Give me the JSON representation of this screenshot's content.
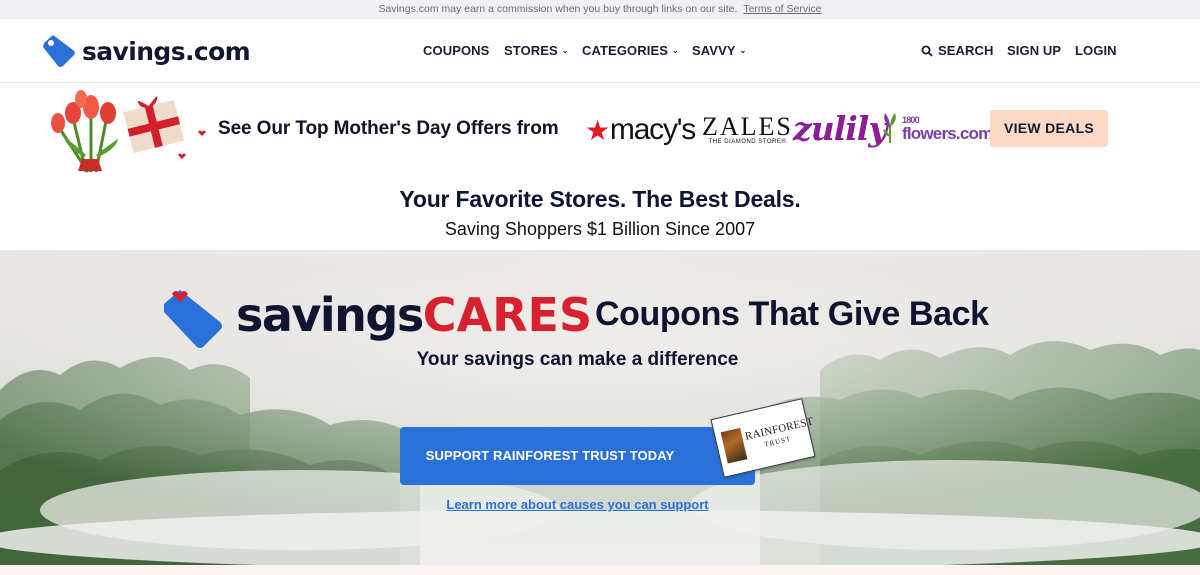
{
  "disclaimer": {
    "text": "Savings.com may earn a commission when you buy through links on our site.",
    "link": "Terms of Service"
  },
  "header": {
    "logo_text": "savings.com",
    "nav": [
      {
        "label": "COUPONS",
        "has_dropdown": false
      },
      {
        "label": "STORES",
        "has_dropdown": true
      },
      {
        "label": "CATEGORIES",
        "has_dropdown": true
      },
      {
        "label": "SAVVY",
        "has_dropdown": true
      }
    ],
    "search_label": "SEARCH",
    "signup_label": "SIGN UP",
    "login_label": "LOGIN",
    "brand_color": "#2b6fd8"
  },
  "promo": {
    "text": "See Our Top Mother's Day Offers from",
    "brands": {
      "macys": "macy's",
      "zales": "ZALES",
      "zales_tagline": "THE DIAMOND STORE®",
      "zulily": "zulily",
      "flowers_num": "1800",
      "flowers": "flowers.com"
    },
    "button": "VIEW DEALS",
    "button_color": "#fcd9c6"
  },
  "hero": {
    "title": "Your Favorite Stores. The Best Deals.",
    "subtitle": "Saving Shoppers $1 Billion Since 2007"
  },
  "cares": {
    "word_main": "savings",
    "word_accent": "CARES",
    "tagline": "Coupons That Give Back",
    "subtitle": "Your savings can make a difference",
    "button": "SUPPORT RAINFOREST TRUST TODAY",
    "badge_line1": "RAINFOREST",
    "badge_line2": "TRUST",
    "link": "Learn more about causes you can support",
    "accent_color": "#d7212f"
  }
}
